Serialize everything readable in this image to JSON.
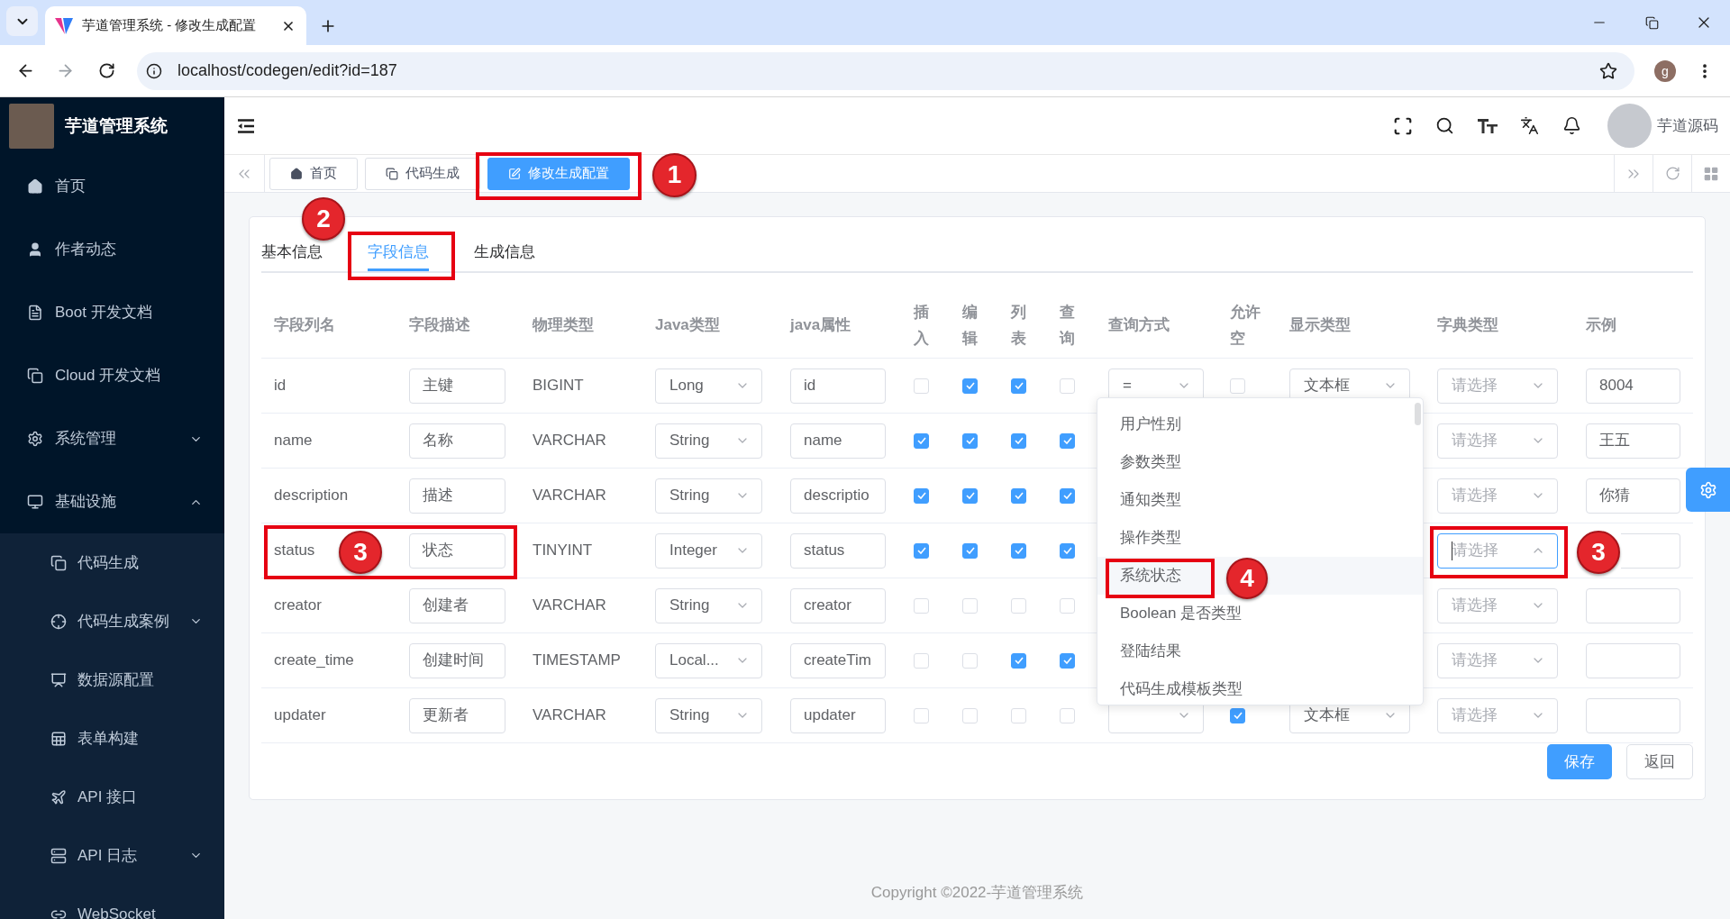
{
  "browser": {
    "tab_title": "芋道管理系统 - 修改生成配置",
    "url": "localhost/codegen/edit?id=187",
    "profile_initial": "g"
  },
  "sidebar": {
    "title": "芋道管理系统",
    "items": [
      {
        "kind": "link",
        "label": "首页"
      },
      {
        "kind": "link",
        "label": "作者动态"
      },
      {
        "kind": "link",
        "label": "Boot 开发文档"
      },
      {
        "kind": "link",
        "label": "Cloud 开发文档"
      },
      {
        "kind": "group",
        "label": "系统管理",
        "expanded": false
      },
      {
        "kind": "group",
        "label": "基础设施",
        "expanded": true,
        "children": [
          {
            "kind": "link",
            "label": "代码生成"
          },
          {
            "kind": "group",
            "label": "代码生成案例",
            "expanded": false
          },
          {
            "kind": "link",
            "label": "数据源配置"
          },
          {
            "kind": "link",
            "label": "表单构建"
          },
          {
            "kind": "link",
            "label": "API 接口"
          },
          {
            "kind": "group",
            "label": "API 日志",
            "expanded": false
          },
          {
            "kind": "link",
            "label": "WebSocket"
          }
        ]
      }
    ]
  },
  "header": {
    "user_name": "芋道源码"
  },
  "tags": [
    {
      "label": "首页",
      "selected": false
    },
    {
      "label": "代码生成",
      "selected": false
    },
    {
      "label": "修改生成配置",
      "selected": true,
      "callout": "1"
    }
  ],
  "tabs": [
    {
      "label": "基本信息",
      "selected": false
    },
    {
      "label": "字段信息",
      "selected": true,
      "callout": "2"
    },
    {
      "label": "生成信息",
      "selected": false
    }
  ],
  "table": {
    "columns": [
      "字段列名",
      "字段描述",
      "物理类型",
      "Java类型",
      "java属性",
      "插入",
      "编辑",
      "列表",
      "查询",
      "查询方式",
      "允许空",
      "显示类型",
      "字典类型",
      "示例"
    ],
    "rows": [
      {
        "name": "id",
        "comment": "主键",
        "db_type": "BIGINT",
        "java_type": "Long",
        "java_field": "id",
        "insert": false,
        "edit": true,
        "list": true,
        "query": false,
        "query_type": {
          "value": "=",
          "open": false
        },
        "nullable": false,
        "display": {
          "value": "文本框",
          "open": false
        },
        "dict": {
          "placeholder": "请选择",
          "open": false
        },
        "example": "8004"
      },
      {
        "name": "name",
        "comment": "名称",
        "db_type": "VARCHAR",
        "java_type": "String",
        "java_field": "name",
        "insert": true,
        "edit": true,
        "list": true,
        "query": true,
        "dict": {
          "placeholder": "请选择",
          "open": false
        },
        "example": "王五"
      },
      {
        "name": "description",
        "comment": "描述",
        "db_type": "VARCHAR",
        "java_type": "String",
        "java_field": "descriptio",
        "insert": true,
        "edit": true,
        "list": true,
        "query": true,
        "dict": {
          "placeholder": "请选择",
          "open": false
        },
        "example": "你猜"
      },
      {
        "name": "status",
        "comment": "状态",
        "db_type": "TINYINT",
        "java_type": "Integer",
        "java_field": "status",
        "insert": true,
        "edit": true,
        "list": true,
        "query": true,
        "callout": "3",
        "dict": {
          "placeholder": "请选择",
          "open": true,
          "callout": "3",
          "options": [
            {
              "label": "用户性别",
              "highlighted": false
            },
            {
              "label": "参数类型",
              "highlighted": false
            },
            {
              "label": "通知类型",
              "highlighted": false
            },
            {
              "label": "操作类型",
              "highlighted": false
            },
            {
              "label": "系统状态",
              "highlighted": true,
              "callout": "4"
            },
            {
              "label": "Boolean 是否类型",
              "highlighted": false
            },
            {
              "label": "登陆结果",
              "highlighted": false
            },
            {
              "label": "代码生成模板类型",
              "highlighted": false
            }
          ]
        }
      },
      {
        "name": "creator",
        "comment": "创建者",
        "db_type": "VARCHAR",
        "java_type": "String",
        "java_field": "creator",
        "insert": false,
        "edit": false,
        "list": false,
        "query": false,
        "dict": {
          "placeholder": "请选择",
          "open": false
        }
      },
      {
        "name": "create_time",
        "comment": "创建时间",
        "db_type": "TIMESTAMP",
        "java_type": "Local...",
        "java_field": "createTim",
        "insert": false,
        "edit": false,
        "list": true,
        "query": true,
        "dict": {
          "placeholder": "请选择",
          "open": false
        }
      },
      {
        "name": "updater",
        "comment": "更新者",
        "db_type": "VARCHAR",
        "java_type": "String",
        "java_field": "updater",
        "insert": false,
        "edit": false,
        "list": false,
        "query": false,
        "query_type": {
          "open": false
        },
        "nullable": true,
        "display": {
          "value": "文本框",
          "open": false
        },
        "dict": {
          "placeholder": "请选择",
          "open": false
        }
      }
    ]
  },
  "buttons": [
    {
      "label": "保存",
      "kind": "primary"
    },
    {
      "label": "返回",
      "kind": "default"
    }
  ],
  "footer": "Copyright ©2022-芋道管理系统"
}
